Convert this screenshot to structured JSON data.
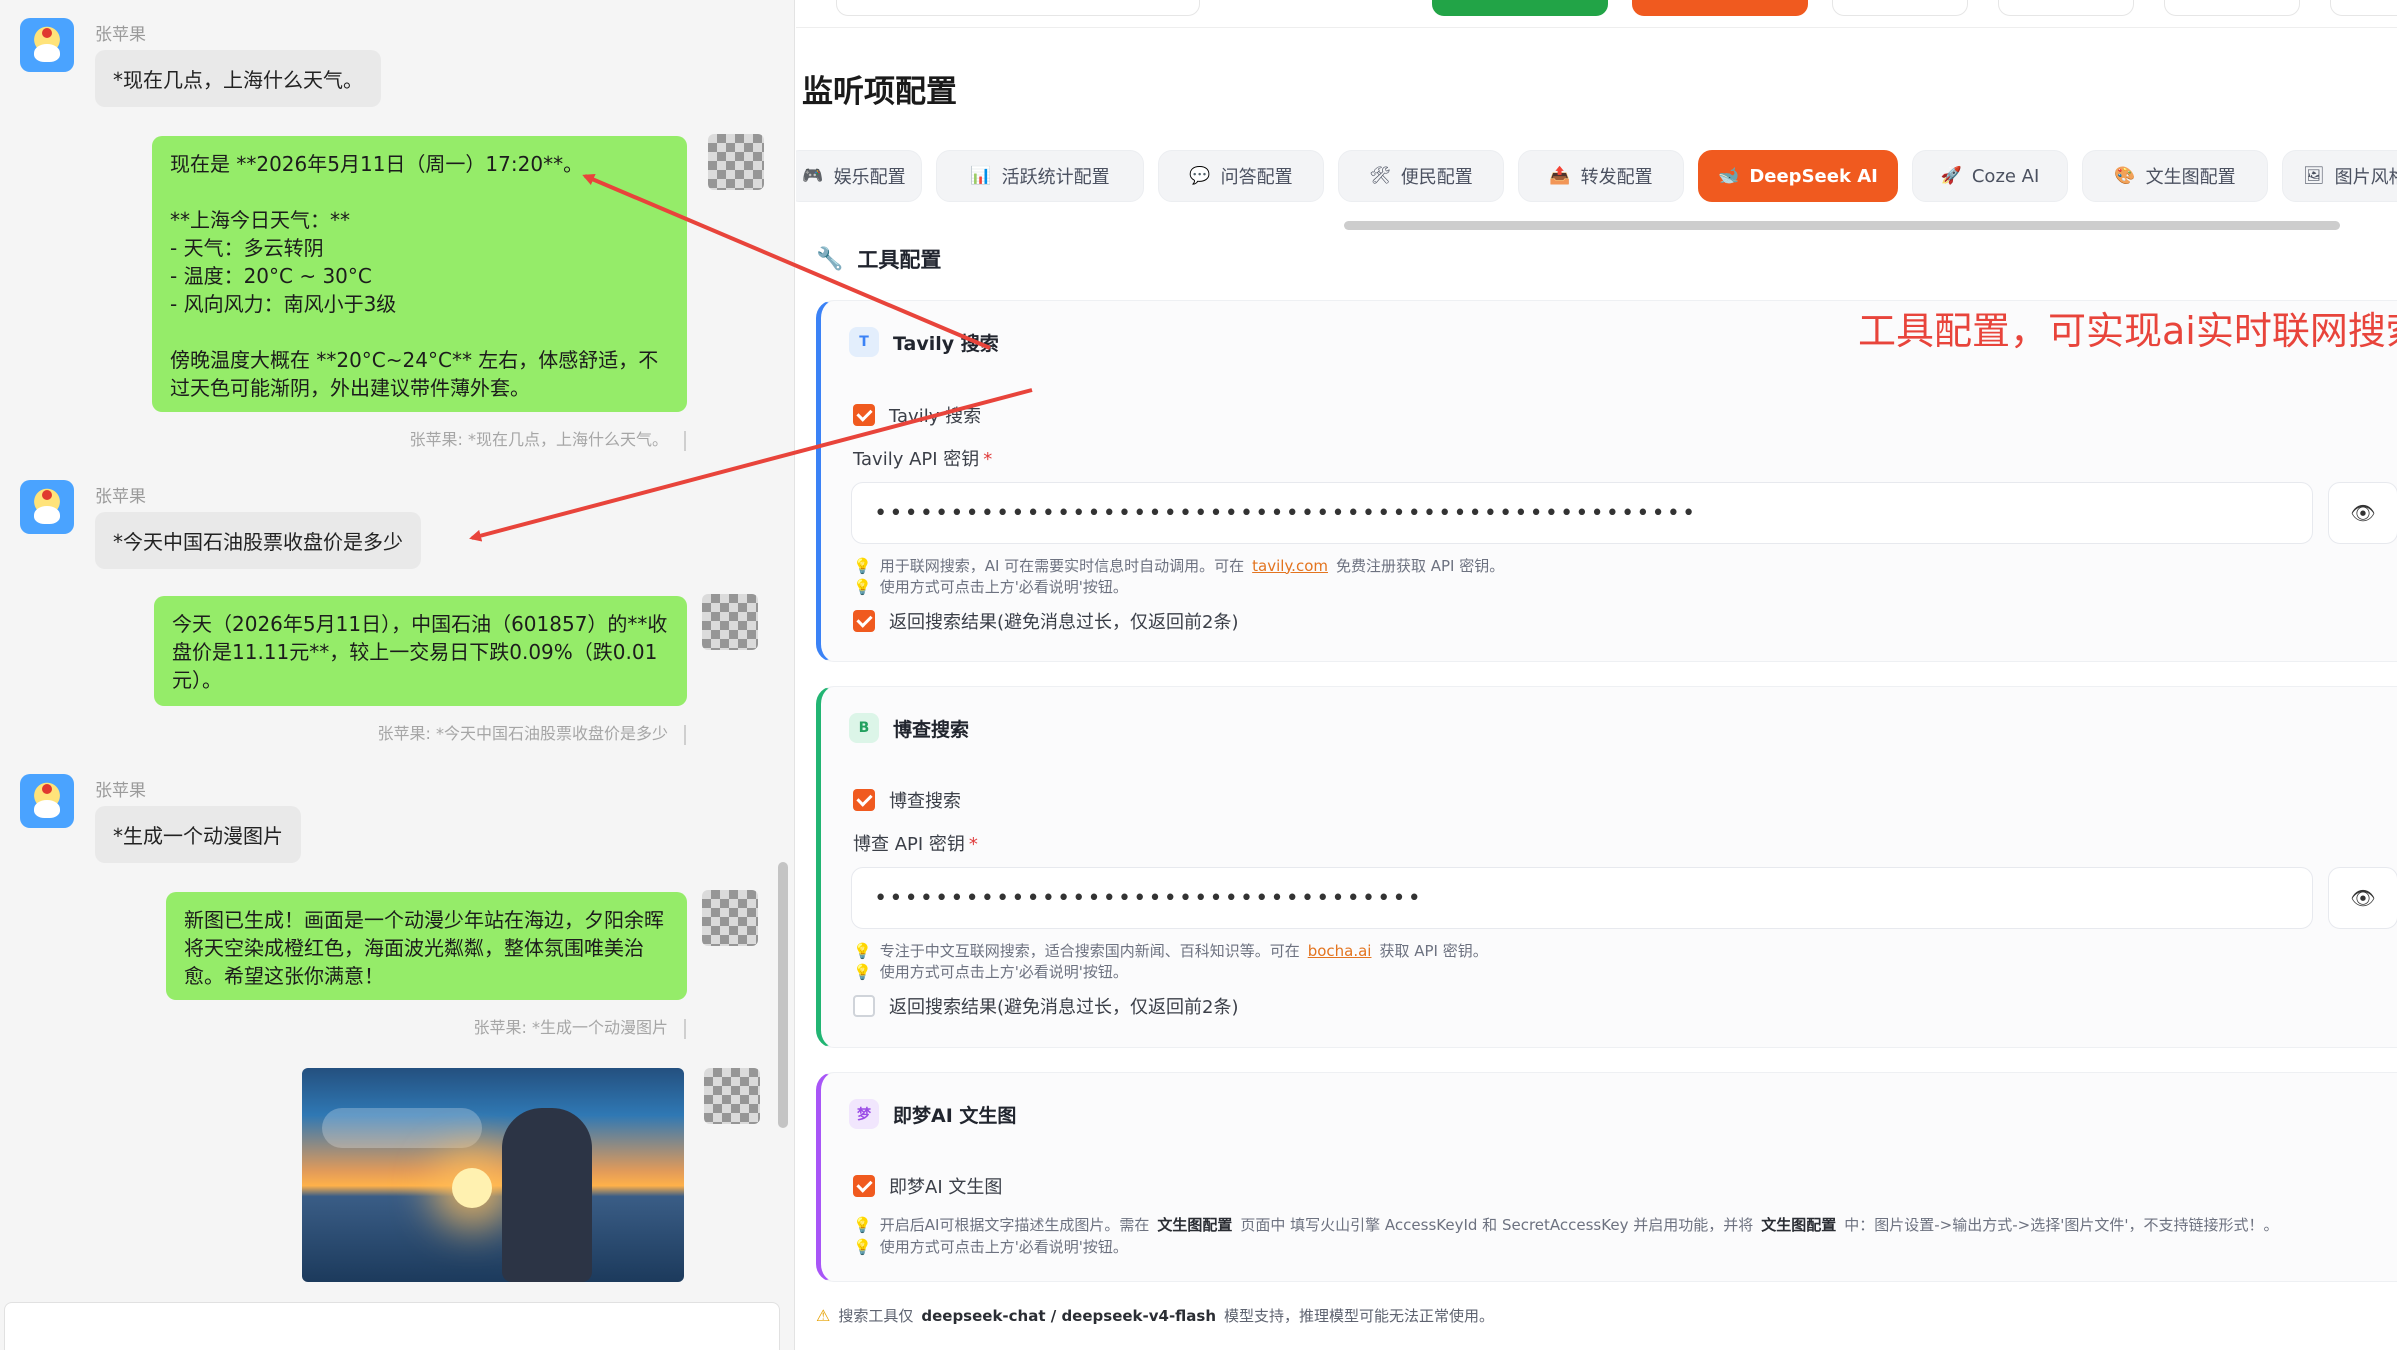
{
  "chat": {
    "sender": "张苹果",
    "messages": [
      {
        "question": "*现在几点，上海什么天气。",
        "answer": "现在是 **2026年5月11日（周一）17:20**。\n\n**上海今日天气：**\n- 天气：多云转阴\n- 温度：20°C ~ 30°C\n- 风向风力：南风小于3级\n\n傍晚温度大概在 **20°C~24°C** 左右，体感舒适，不过天色可能渐阴，外出建议带件薄外套。",
        "quote": "张苹果: *现在几点，上海什么天气。"
      },
      {
        "question": "*今天中国石油股票收盘价是多少",
        "answer": "今天（2026年5月11日），中国石油（601857）的**收盘价是11.11元**，较上一交易日下跌0.09%（跌0.01元）。",
        "quote": "张苹果: *今天中国石油股票收盘价是多少"
      },
      {
        "question": "*生成一个动漫图片",
        "answer": "新图已生成！画面是一个动漫少年站在海边，夕阳余晖将天空染成橙红色，海面波光粼粼，整体氛围唯美治愈。希望这张你满意！",
        "quote": "张苹果: *生成一个动漫图片"
      }
    ]
  },
  "config": {
    "title": "监听项配置",
    "tabs": [
      {
        "label": "娱乐配置",
        "icon": "🎮"
      },
      {
        "label": "活跃统计配置",
        "icon": "📊"
      },
      {
        "label": "问答配置",
        "icon": "💬"
      },
      {
        "label": "便民配置",
        "icon": "🛠"
      },
      {
        "label": "转发配置",
        "icon": "📤"
      },
      {
        "label": "DeepSeek AI",
        "icon": "🐋"
      },
      {
        "label": "Coze AI",
        "icon": "🚀"
      },
      {
        "label": "文生图配置",
        "icon": "🎨"
      },
      {
        "label": "图片风格",
        "icon": "🖼"
      }
    ],
    "active_tab": "DeepSeek AI",
    "tools_heading": "工具配置",
    "tavily": {
      "badge": "T",
      "title": "Tavily 搜索",
      "enable_label": "Tavily 搜索",
      "key_label": "Tavily API 密钥",
      "key_value": "••••••••••••••••••••••••••••••••••••••••••••••••••••••",
      "hint1_pre": "用于联网搜索，AI 可在需要实时信息时自动调用。可在",
      "hint1_link": "tavily.com",
      "hint1_post": "免费注册获取 API 密钥。",
      "hint2": "使用方式可点击上方'必看说明'按钮。",
      "return_label": "返回搜索结果(避免消息过长，仅返回前2条)",
      "return_checked": true
    },
    "bocha": {
      "badge": "B",
      "title": "博查搜索",
      "enable_label": "博查搜索",
      "key_label": "博查 API 密钥",
      "key_value": "••••••••••••••••••••••••••••••••••••",
      "hint1_pre": "专注于中文互联网搜索，适合搜索国内新闻、百科知识等。可在",
      "hint1_link": "bocha.ai",
      "hint1_post": "获取 API 密钥。",
      "hint2": "使用方式可点击上方'必看说明'按钮。",
      "return_label": "返回搜索结果(避免消息过长，仅返回前2条)",
      "return_checked": false
    },
    "jimeng": {
      "badge": "梦",
      "title": "即梦AI 文生图",
      "enable_label": "即梦AI 文生图",
      "hint1_a": "开启后AI可根据文字描述生成图片。需在",
      "hint1_b": "文生图配置",
      "hint1_c": "页面中 填写火山引擎 AccessKeyId 和 SecretAccessKey 并启用功能，并将",
      "hint1_d": "文生图配置",
      "hint1_e": "中：图片设置->输出方式->选择'图片文件'，不支持链接形式！。",
      "hint2": "使用方式可点击上方'必看说明'按钮。"
    },
    "footnote_a": "搜索工具仅",
    "footnote_b": "deepseek-chat / deepseek-v4-flash",
    "footnote_c": "模型支持，推理模型可能无法正常使用。"
  },
  "annotation": {
    "text": "工具配置，可实现ai实时联网搜索，获取最新资讯信息。",
    "color": "#e8443b"
  },
  "colors": {
    "accent": "#f05a1f",
    "bubble_out": "#95ec69",
    "tavily_border": "#3b82f6",
    "bocha_border": "#22b573",
    "jimeng_border": "#a855f7"
  }
}
